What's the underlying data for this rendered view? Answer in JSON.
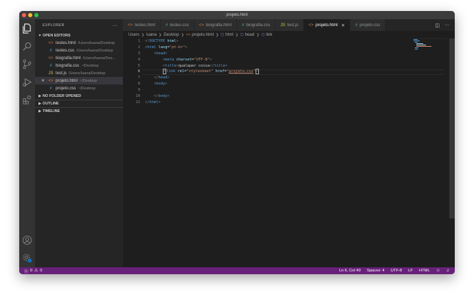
{
  "window": {
    "title": "projeto.html"
  },
  "explorer": {
    "title": "EXPLORER",
    "more": "···",
    "open_editors_label": "OPEN EDITORS",
    "open_editors": [
      {
        "name": "testes.html",
        "path": "/Users/luana/Desktop",
        "icon": "html-file-icon",
        "glyph": "<>",
        "color": "#e37933"
      },
      {
        "name": "testes.css",
        "path": "/Users/luana/Desktop",
        "icon": "css-file-icon",
        "glyph": "#",
        "color": "#519aba"
      },
      {
        "name": "biografia.html",
        "path": "/Users/luana/Des...",
        "icon": "html-file-icon",
        "glyph": "<>",
        "color": "#e37933"
      },
      {
        "name": "biografia.css",
        "path": "~/Desktop",
        "icon": "css-file-icon",
        "glyph": "#",
        "color": "#519aba"
      },
      {
        "name": "test.js",
        "path": "/Users/luana/Desktop",
        "icon": "js-file-icon",
        "glyph": "JS",
        "color": "#cbcb41"
      },
      {
        "name": "projeto.html",
        "path": "~/Desktop",
        "icon": "html-file-icon",
        "glyph": "<>",
        "color": "#e37933",
        "active": true,
        "close": "✕"
      },
      {
        "name": "projeto.css",
        "path": "~/Desktop",
        "icon": "css-file-icon",
        "glyph": "#",
        "color": "#519aba"
      }
    ],
    "no_folder_label": "NO FOLDER OPENED",
    "outline_label": "OUTLINE",
    "timeline_label": "TIMELINE"
  },
  "tabs": [
    {
      "label": "testes.html",
      "glyph": "<>",
      "color": "#e37933"
    },
    {
      "label": "testes.css",
      "glyph": "#",
      "color": "#519aba"
    },
    {
      "label": "biografia.html",
      "glyph": "<>",
      "color": "#e37933"
    },
    {
      "label": "biografia.css",
      "glyph": "#",
      "color": "#519aba"
    },
    {
      "label": "test.js",
      "glyph": "JS",
      "color": "#cbcb41"
    },
    {
      "label": "projeto.html",
      "glyph": "<>",
      "color": "#e37933",
      "active": true,
      "close": "✕"
    },
    {
      "label": "projeto.css",
      "glyph": "#",
      "color": "#519aba"
    }
  ],
  "breadcrumb": {
    "items": [
      "Users",
      "luana",
      "Desktop",
      "projeto.html",
      "html",
      "head",
      "link"
    ]
  },
  "editor": {
    "line_numbers": [
      "1",
      "2",
      "3",
      "4",
      "5",
      "6",
      "7",
      "8",
      "9",
      "10",
      "11"
    ]
  },
  "statusbar": {
    "errors": "0",
    "warnings": "0",
    "position": "Ln 6, Col 49",
    "spaces": "Spaces: 4",
    "encoding": "UTF-8",
    "eol": "LF",
    "language": "HTML"
  },
  "colors": {
    "statusbar": "#68217a",
    "editor_bg": "#1e1e1e",
    "sidebar_bg": "#252526",
    "activitybar_bg": "#333333"
  }
}
